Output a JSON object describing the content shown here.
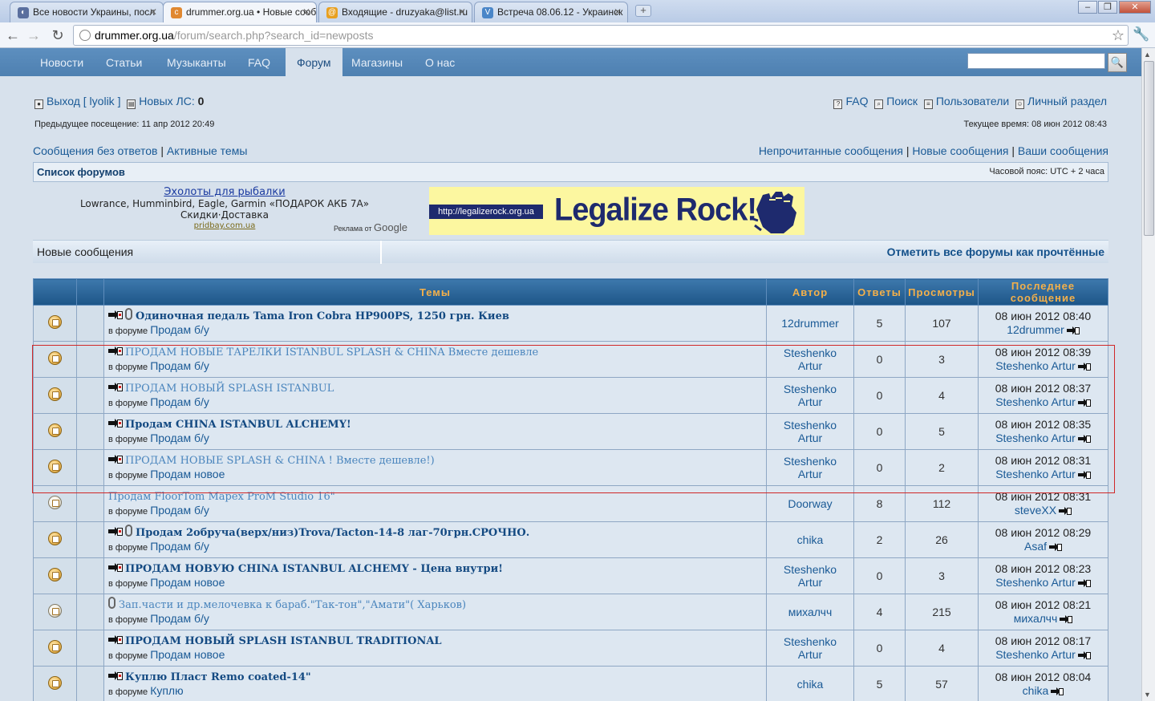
{
  "browser": {
    "tabs": [
      {
        "title": "Все новости Украины, посл",
        "icon_color": "#5a6f9e",
        "active": false
      },
      {
        "title": "drummer.org.ua • Новые сооб",
        "icon_color": "#e08830",
        "active": true
      },
      {
        "title": "Входящие - druzyaka@list.ru",
        "icon_color": "#e8a020",
        "active": false
      },
      {
        "title": "Встреча 08.06.12 - Украинск",
        "icon_color": "#4a86c8",
        "active": false
      }
    ],
    "url_host": "drummer.org.ua",
    "url_path": "/forum/search.php?search_id=newposts"
  },
  "site_nav": {
    "items": [
      "Новости",
      "Статьи",
      "Музыканты",
      "FAQ",
      "Форум",
      "Магазины",
      "О нас"
    ],
    "active": "Форум",
    "search_placeholder": ""
  },
  "header": {
    "logout": "Выход [ lyolik ]",
    "new_pm_label": "Новых ЛС:",
    "new_pm_count": "0",
    "faq": "FAQ",
    "search": "Поиск",
    "users": "Пользователи",
    "ucp": "Личный раздел",
    "prev_visit": "Предыдущее посещение: 11 апр 2012 20:49",
    "current_time": "Текущее время: 08 июн 2012 08:43",
    "unanswered": "Сообщения без ответов",
    "active_topics": "Активные темы",
    "unread": "Непрочитанные сообщения",
    "new_posts": "Новые сообщения",
    "your_posts": "Ваши сообщения",
    "forum_index": "Список форумов",
    "timezone": "Часовой пояс: UTC + 2 часа"
  },
  "ad": {
    "title": "Эхолоты для рыбалки",
    "line1": "Lowrance, Humminbird, Eagle, Garmin «ПОДАРОК АКБ 7А»",
    "line2": "Скидки·Доставка",
    "url": "pridbay.com.ua",
    "google_label": "Реклама от",
    "google_brand": "Google"
  },
  "banner": {
    "url": "http://legalizerock.org.ua",
    "slogan": "Legalize Rock!"
  },
  "section": {
    "title": "Новые сообщения",
    "mark_all": "Отметить все форумы как прочтённые"
  },
  "table": {
    "headers": {
      "topics": "Темы",
      "author": "Автор",
      "replies": "Ответы",
      "views": "Просмотры",
      "last_post": "Последнее сообщение"
    },
    "in_forum_label": "в форуме",
    "rows": [
      {
        "title": "Одиночная педаль Tama Iron Cobra HP900PS, 1250 грн. Киев",
        "forum": "Продам б/у",
        "author": "12drummer",
        "replies": "5",
        "views": "107",
        "last_time": "08 июн 2012 08:40",
        "last_author": "12drummer",
        "new_icon": true,
        "clip": true,
        "style": "bold",
        "read": false
      },
      {
        "title": "ПРОДАМ НОВЫЕ ТАРЕЛКИ ISTANBUL SPLASH & CHINA Вместе дешевле",
        "forum": "Продам б/у",
        "author": "Steshenko Artur",
        "replies": "0",
        "views": "3",
        "last_time": "08 июн 2012 08:39",
        "last_author": "Steshenko Artur",
        "new_icon": true,
        "clip": false,
        "style": "light",
        "read": false
      },
      {
        "title": "ПРОДАМ НОВЫЙ SPLASH ISTANBUL",
        "forum": "Продам б/у",
        "author": "Steshenko Artur",
        "replies": "0",
        "views": "4",
        "last_time": "08 июн 2012 08:37",
        "last_author": "Steshenko Artur",
        "new_icon": true,
        "clip": false,
        "style": "light",
        "read": false
      },
      {
        "title": "Продам CHINA ISTANBUL ALCHEMY!",
        "forum": "Продам б/у",
        "author": "Steshenko Artur",
        "replies": "0",
        "views": "5",
        "last_time": "08 июн 2012 08:35",
        "last_author": "Steshenko Artur",
        "new_icon": true,
        "clip": false,
        "style": "bold",
        "read": false
      },
      {
        "title": "ПРОДАМ НОВЫЕ SPLASH & CHINA ! Вместе дешевле!)",
        "forum": "Продам новое",
        "author": "Steshenko Artur",
        "replies": "0",
        "views": "2",
        "last_time": "08 июн 2012 08:31",
        "last_author": "Steshenko Artur",
        "new_icon": true,
        "clip": false,
        "style": "light",
        "read": false
      },
      {
        "title": "Продам FloorTom Mapex ProM Studio 16\"",
        "forum": "Продам б/у",
        "author": "Doorway",
        "replies": "8",
        "views": "112",
        "last_time": "08 июн 2012 08:31",
        "last_author": "steveXX",
        "new_icon": false,
        "clip": false,
        "style": "light",
        "read": true
      },
      {
        "title": "Продам 2обруча(верх/низ)Trova/Tacton-14-8 лаг-70грн.СРОЧНО.",
        "forum": "Продам б/у",
        "author": "chika",
        "replies": "2",
        "views": "26",
        "last_time": "08 июн 2012 08:29",
        "last_author": "Asaf",
        "new_icon": true,
        "clip": true,
        "style": "bold",
        "read": false
      },
      {
        "title": "ПРОДАМ НОВУЮ CHINA ISTANBUL ALCHEMY - Цена внутри!",
        "forum": "Продам новое",
        "author": "Steshenko Artur",
        "replies": "0",
        "views": "3",
        "last_time": "08 июн 2012 08:23",
        "last_author": "Steshenko Artur",
        "new_icon": true,
        "clip": false,
        "style": "bold",
        "read": false
      },
      {
        "title": "Зап.части и др.мелочевка к бараб.\"Так-тон\",\"Амати\"( Харьков)",
        "forum": "Продам б/у",
        "author": "михалчч",
        "replies": "4",
        "views": "215",
        "last_time": "08 июн 2012 08:21",
        "last_author": "михалчч",
        "new_icon": false,
        "clip": true,
        "style": "light",
        "read": true
      },
      {
        "title": "ПРОДАМ НОВЫЙ SPLASH ISTANBUL TRADITIONAL",
        "forum": "Продам новое",
        "author": "Steshenko Artur",
        "replies": "0",
        "views": "4",
        "last_time": "08 июн 2012 08:17",
        "last_author": "Steshenko Artur",
        "new_icon": true,
        "clip": false,
        "style": "bold",
        "read": false
      },
      {
        "title": "Куплю Пласт Remo coated-14\"",
        "forum": "Куплю",
        "author": "chika",
        "replies": "5",
        "views": "57",
        "last_time": "08 июн 2012 08:04",
        "last_author": "chika",
        "new_icon": true,
        "clip": false,
        "style": "bold",
        "read": false
      }
    ]
  },
  "colors": {
    "nav_bg": "#5d8fbf",
    "page_bg": "#d7e1ec",
    "header_text": "#f4b04a",
    "link": "#1a5a96",
    "highlight": "#d02828"
  }
}
